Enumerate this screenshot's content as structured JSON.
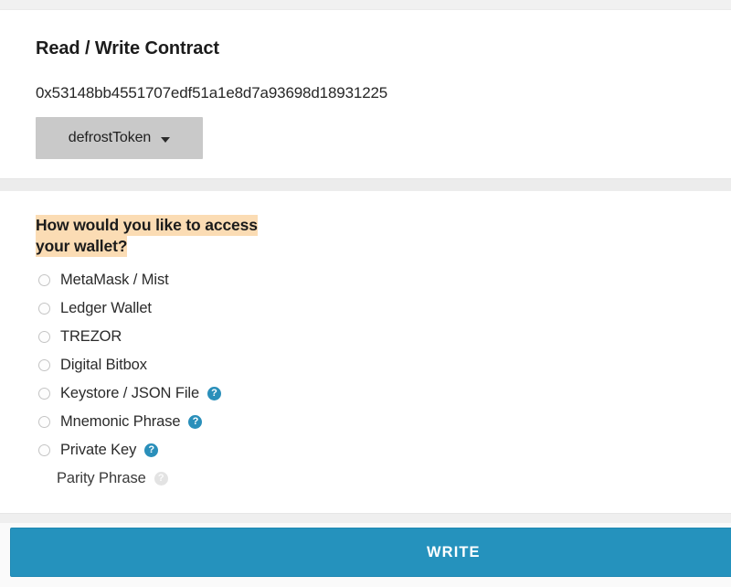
{
  "contract_section": {
    "title": "Read / Write Contract",
    "address": "0x53148bb4551707edf51a1e8d7a93698d18931225",
    "function_dropdown": {
      "selected": "defrostToken",
      "caret_icon": "chevron-down-icon"
    }
  },
  "wallet_section": {
    "heading_line1": "How would you like to access",
    "heading_line2": "your wallet?",
    "highlight_color": "#fbdcb4",
    "options": [
      {
        "label": "MetaMask / Mist",
        "has_radio": true,
        "has_help": false,
        "help_muted": false,
        "selected": false
      },
      {
        "label": "Ledger Wallet",
        "has_radio": true,
        "has_help": false,
        "help_muted": false,
        "selected": false
      },
      {
        "label": "TREZOR",
        "has_radio": true,
        "has_help": false,
        "help_muted": false,
        "selected": false
      },
      {
        "label": "Digital Bitbox",
        "has_radio": true,
        "has_help": false,
        "help_muted": false,
        "selected": false
      },
      {
        "label": "Keystore / JSON File",
        "has_radio": true,
        "has_help": true,
        "help_muted": false,
        "selected": false
      },
      {
        "label": "Mnemonic Phrase",
        "has_radio": true,
        "has_help": true,
        "help_muted": false,
        "selected": false
      },
      {
        "label": "Private Key",
        "has_radio": true,
        "has_help": true,
        "help_muted": false,
        "selected": false
      },
      {
        "label": "Parity Phrase",
        "has_radio": false,
        "has_help": true,
        "help_muted": true,
        "selected": false
      }
    ],
    "help_icon_glyph": "?",
    "help_icon_color": "#2a8fba",
    "help_icon_muted_color": "#e3e3e3"
  },
  "footer": {
    "write_label": "WRITE",
    "write_color": "#2592bd"
  }
}
